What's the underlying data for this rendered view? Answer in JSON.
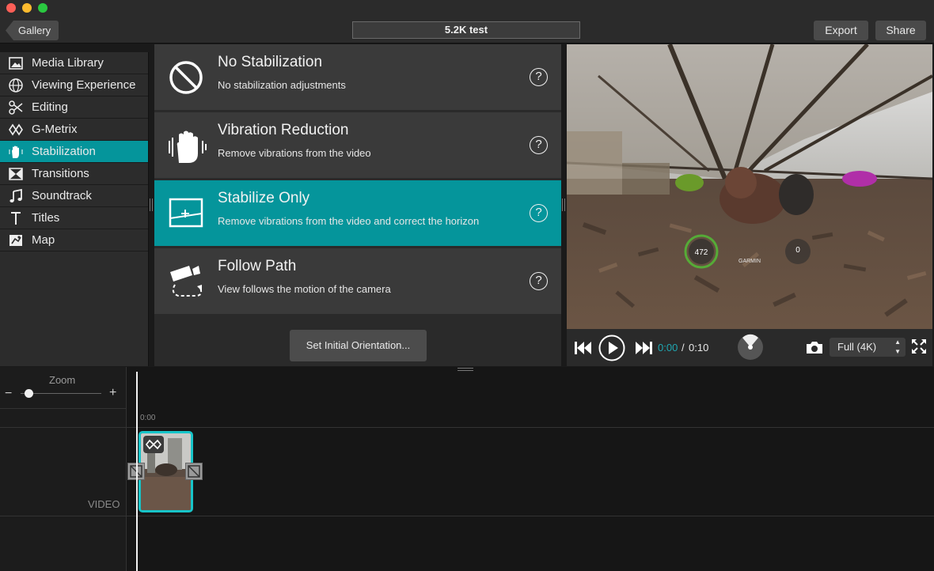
{
  "window": {
    "title": "5.2K test",
    "back_label": "Gallery",
    "export_label": "Export",
    "share_label": "Share"
  },
  "sidebar": {
    "items": [
      {
        "label": "Media Library",
        "icon": "media-library-icon"
      },
      {
        "label": "Viewing Experience",
        "icon": "globe-icon"
      },
      {
        "label": "Editing",
        "icon": "scissors-icon"
      },
      {
        "label": "G-Metrix",
        "icon": "gmetrix-icon"
      },
      {
        "label": "Stabilization",
        "icon": "hand-icon",
        "active": true
      },
      {
        "label": "Transitions",
        "icon": "bowtie-icon"
      },
      {
        "label": "Soundtrack",
        "icon": "music-note-icon"
      },
      {
        "label": "Titles",
        "icon": "text-t-icon"
      },
      {
        "label": "Map",
        "icon": "map-icon"
      }
    ]
  },
  "stabilization": {
    "options": [
      {
        "title": "No Stabilization",
        "description": "No stabilization adjustments",
        "icon": "no-symbol-icon"
      },
      {
        "title": "Vibration Reduction",
        "description": "Remove vibrations from the video",
        "icon": "vibrating-hand-icon"
      },
      {
        "title": "Stabilize Only",
        "description": "Remove vibrations from the video and correct the horizon",
        "icon": "horizon-frame-icon",
        "active": true
      },
      {
        "title": "Follow Path",
        "description": "View follows the motion of the camera",
        "icon": "camera-path-icon"
      }
    ],
    "help_label": "?",
    "orientation_button": "Set Initial Orientation..."
  },
  "player": {
    "current_time": "0:00",
    "separator": "/",
    "total_time": "0:10",
    "quality": "Full (4K)",
    "overlay": {
      "speed_value": "472",
      "brand": "GARMIN",
      "gauge_value": "0"
    }
  },
  "timeline": {
    "zoom_label": "Zoom",
    "zoom_minus": "−",
    "zoom_plus": "+",
    "ruler_start": "0:00",
    "track_label": "VIDEO"
  },
  "colors": {
    "accent": "#05959b",
    "clip_border": "#17c4c8",
    "time_current": "#1fa7b2"
  }
}
